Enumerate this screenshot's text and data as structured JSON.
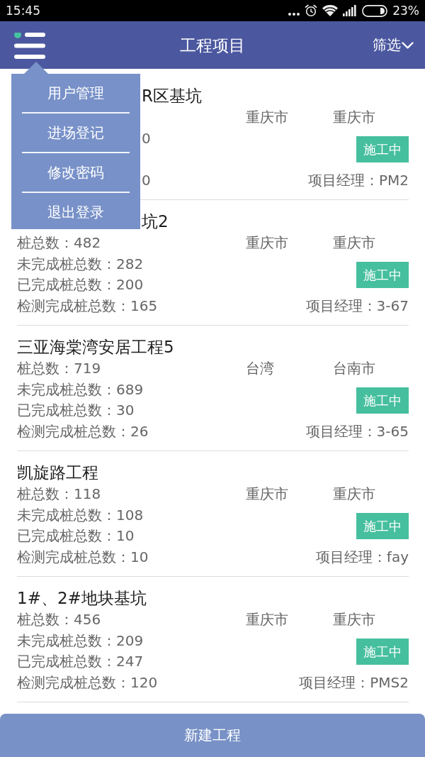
{
  "status_bar": {
    "time": "15:45",
    "battery": "23%"
  },
  "header": {
    "title": "工程项目",
    "filter": "筛选",
    "menu_dot": true
  },
  "menu": {
    "items": [
      "用户管理",
      "进场登记",
      "修改密码",
      "退出登录"
    ]
  },
  "projects": [
    {
      "title": "R区基坑",
      "stats": {
        "unfinished": "0",
        "tested": "0"
      },
      "province": "重庆市",
      "city": "重庆市",
      "status": "施工中",
      "manager": "项目经理：PM2"
    },
    {
      "title": "坑2",
      "stats": {
        "total": "桩总数：482",
        "unfinished": "未完成桩总数：282",
        "finished": "已完成桩总数：200",
        "tested": "检测完成桩总数：165"
      },
      "province": "重庆市",
      "city": "重庆市",
      "status": "施工中",
      "manager": "项目经理：3-67"
    },
    {
      "title": "三亚海棠湾安居工程5",
      "stats": {
        "total": "桩总数：719",
        "unfinished": "未完成桩总数：689",
        "finished": "已完成桩总数：30",
        "tested": "检测完成桩总数：26"
      },
      "province": "台湾",
      "city": "台南市",
      "status": "施工中",
      "manager": "项目经理：3-65"
    },
    {
      "title": "凯旋路工程",
      "stats": {
        "total": "桩总数：118",
        "unfinished": "未完成桩总数：108",
        "finished": "已完成桩总数：10",
        "tested": "检测完成桩总数：10"
      },
      "province": "重庆市",
      "city": "重庆市",
      "status": "施工中",
      "manager": "项目经理：fay"
    },
    {
      "title": "1#、2#地块基坑",
      "stats": {
        "total": "桩总数：456",
        "unfinished": "未完成桩总数：209",
        "finished": "已完成桩总数：247",
        "tested": "检测完成桩总数：120"
      },
      "province": "重庆市",
      "city": "重庆市",
      "status": "施工中",
      "manager": "项目经理：PMS2"
    }
  ],
  "new_project_button": "新建工程"
}
